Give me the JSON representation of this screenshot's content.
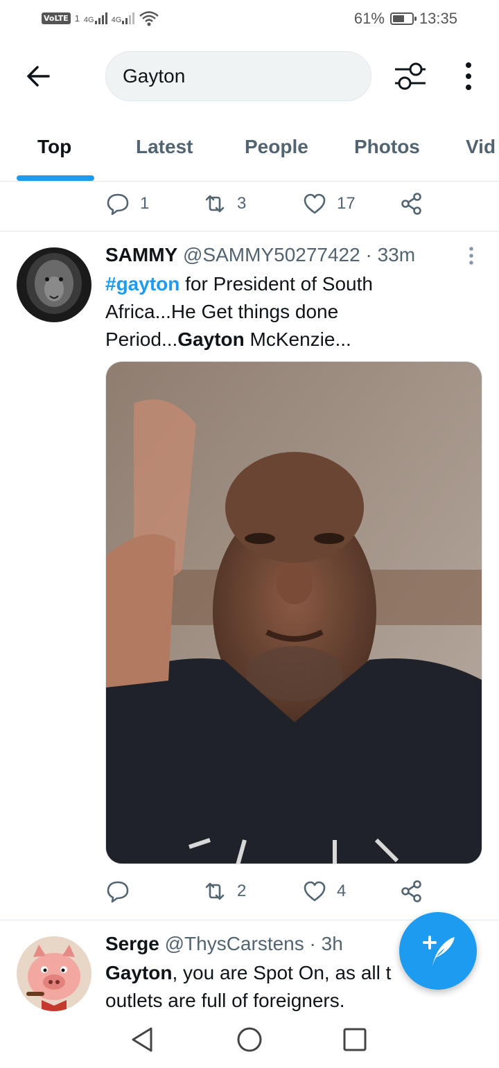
{
  "status_bar": {
    "volte": "VoLTE",
    "sim1": "1",
    "network1": "4G",
    "network2": "4G",
    "battery_percent": "61%",
    "battery_level": 0.61,
    "time": "13:35"
  },
  "header": {
    "search_value": "Gayton",
    "back_icon": "arrow-left-icon",
    "filter_icon": "sliders-icon",
    "more_icon": "more-vertical-icon"
  },
  "tabs": [
    {
      "label": "Top",
      "active": true
    },
    {
      "label": "Latest",
      "active": false
    },
    {
      "label": "People",
      "active": false
    },
    {
      "label": "Photos",
      "active": false
    },
    {
      "label": "Vid",
      "active": false
    }
  ],
  "prev_tweet_actions": {
    "replies": "1",
    "retweets": "3",
    "likes": "17"
  },
  "tweets": [
    {
      "name": "SAMMY",
      "meta": "@SAMMY50277422 · 33m",
      "hashtag": "#gayton",
      "text_1": " for President of South Africa...He Get things done Period...",
      "bold": "Gayton",
      "text_2": " McKenzie...",
      "actions": {
        "replies": "",
        "retweets": "2",
        "likes": "4"
      }
    },
    {
      "name": "Serge",
      "meta": "@ThysCarstens · 3h",
      "bold": "Gayton",
      "text_1": ", you are Spot On, as all t",
      "text_2": "outlets are full of foreigners."
    }
  ],
  "fab": {
    "icon": "compose-tweet-icon",
    "label": "+"
  },
  "colors": {
    "accent": "#1d9bf0",
    "text": "#0f1419",
    "secondary": "#536471"
  }
}
